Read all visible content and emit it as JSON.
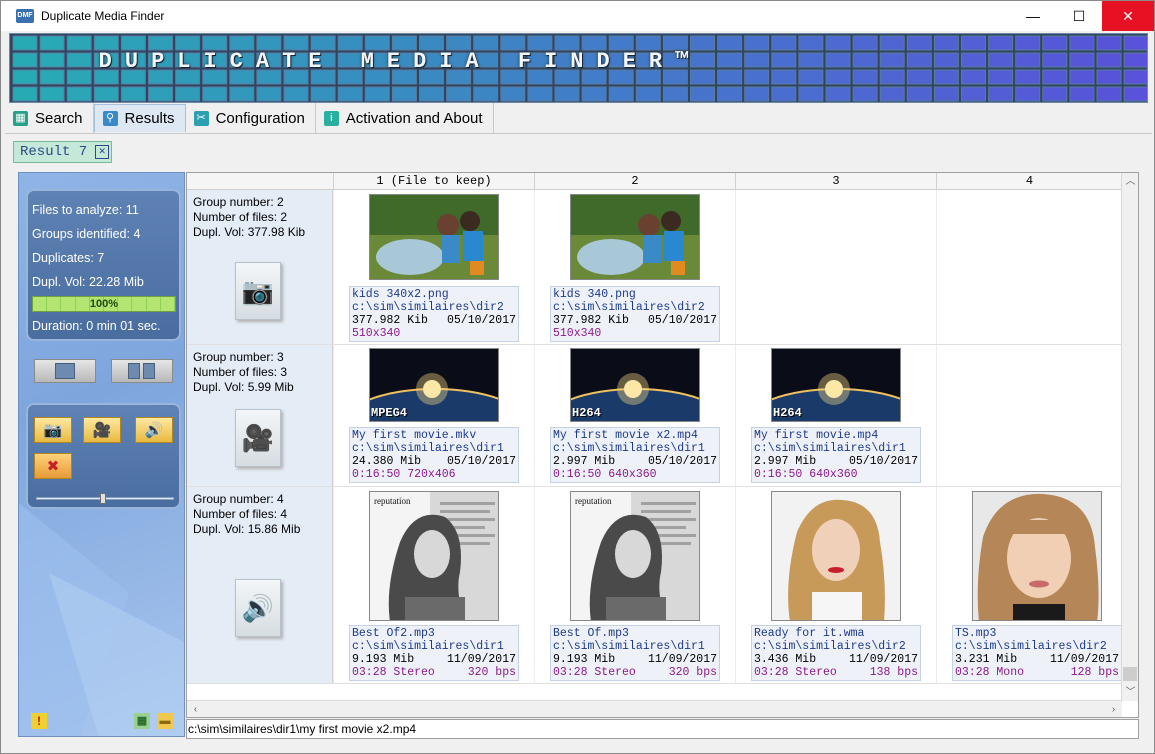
{
  "window": {
    "title": "Duplicate Media Finder",
    "icon_text": "DMF",
    "minimize": "—",
    "maximize": "☐",
    "close": "✕"
  },
  "banner": {
    "title": "DUPLICATE MEDIA FINDER™"
  },
  "tabs": [
    {
      "label": "Search",
      "icon": "search-grid-icon"
    },
    {
      "label": "Results",
      "icon": "magnifier-icon"
    },
    {
      "label": "Configuration",
      "icon": "tools-icon"
    },
    {
      "label": "Activation and About",
      "icon": "info-icon"
    }
  ],
  "result_tab": {
    "label": "Result 7",
    "close": "✕"
  },
  "stats": {
    "files_to_analyze": "Files to analyze: 11",
    "groups_identified": "Groups identified: 4",
    "duplicates": "Duplicates: 7",
    "dupl_vol": "Dupl. Vol: 22.28 Mib",
    "progress_label": "100%",
    "progress_value": 1.0,
    "duration": "Duration: 0 min 01 sec."
  },
  "columns": [
    "1 (File to keep)",
    "2",
    "3",
    "4"
  ],
  "groups": [
    {
      "number": "Group number: 2",
      "files": "Number of files: 2",
      "vol": "Dupl. Vol: 377.98 Kib",
      "type_icon": "camera-icon",
      "items": [
        {
          "name": "kids 340x2.png",
          "path": "c:\\sim\\similaires\\dir2",
          "size": "377.982 Kib",
          "date": "05/10/2017",
          "extra_left": "510x340",
          "extra_right": ""
        },
        {
          "name": "kids 340.png",
          "path": "c:\\sim\\similaires\\dir2",
          "size": "377.982 Kib",
          "date": "05/10/2017",
          "extra_left": "510x340",
          "extra_right": ""
        }
      ]
    },
    {
      "number": "Group number: 3",
      "files": "Number of files: 3",
      "vol": "Dupl. Vol: 5.99 Mib",
      "type_icon": "video-camera-icon",
      "items": [
        {
          "name": "My first movie.mkv",
          "path": "c:\\sim\\similaires\\dir1",
          "size": "24.380 Mib",
          "date": "05/10/2017",
          "extra_left": "0:16:50 720x406",
          "extra_right": "",
          "codec": "MPEG4"
        },
        {
          "name": "My first movie x2.mp4",
          "path": "c:\\sim\\similaires\\dir1",
          "size": "2.997 Mib",
          "date": "05/10/2017",
          "extra_left": "0:16:50 640x360",
          "extra_right": "",
          "codec": "H264"
        },
        {
          "name": "My first movie.mp4",
          "path": "c:\\sim\\similaires\\dir1",
          "size": "2.997 Mib",
          "date": "05/10/2017",
          "extra_left": "0:16:50 640x360",
          "extra_right": "",
          "codec": "H264"
        }
      ]
    },
    {
      "number": "Group number: 4",
      "files": "Number of files: 4",
      "vol": "Dupl. Vol: 15.86 Mib",
      "type_icon": "speaker-icon",
      "items": [
        {
          "name": "Best Of2.mp3",
          "path": "c:\\sim\\similaires\\dir1",
          "size": "9.193 Mib",
          "date": "11/09/2017",
          "extra_left": "03:28 Stereo",
          "extra_right": "320 bps",
          "cover_text": "reputation"
        },
        {
          "name": "Best Of.mp3",
          "path": "c:\\sim\\similaires\\dir1",
          "size": "9.193 Mib",
          "date": "11/09/2017",
          "extra_left": "03:28 Stereo",
          "extra_right": "320 bps",
          "cover_text": "reputation"
        },
        {
          "name": "Ready for it.wma",
          "path": "c:\\sim\\similaires\\dir2",
          "size": "3.436 Mib",
          "date": "11/09/2017",
          "extra_left": "03:28 Stereo",
          "extra_right": "138 bps"
        },
        {
          "name": "TS.mp3",
          "path": "c:\\sim\\similaires\\dir2",
          "size": "3.231 Mib",
          "date": "11/09/2017",
          "extra_left": "03:28 Mono",
          "extra_right": "128 bps"
        }
      ]
    }
  ],
  "statusbar": {
    "path": "c:\\sim\\similaires\\dir1\\my first movie x2.mp4"
  }
}
